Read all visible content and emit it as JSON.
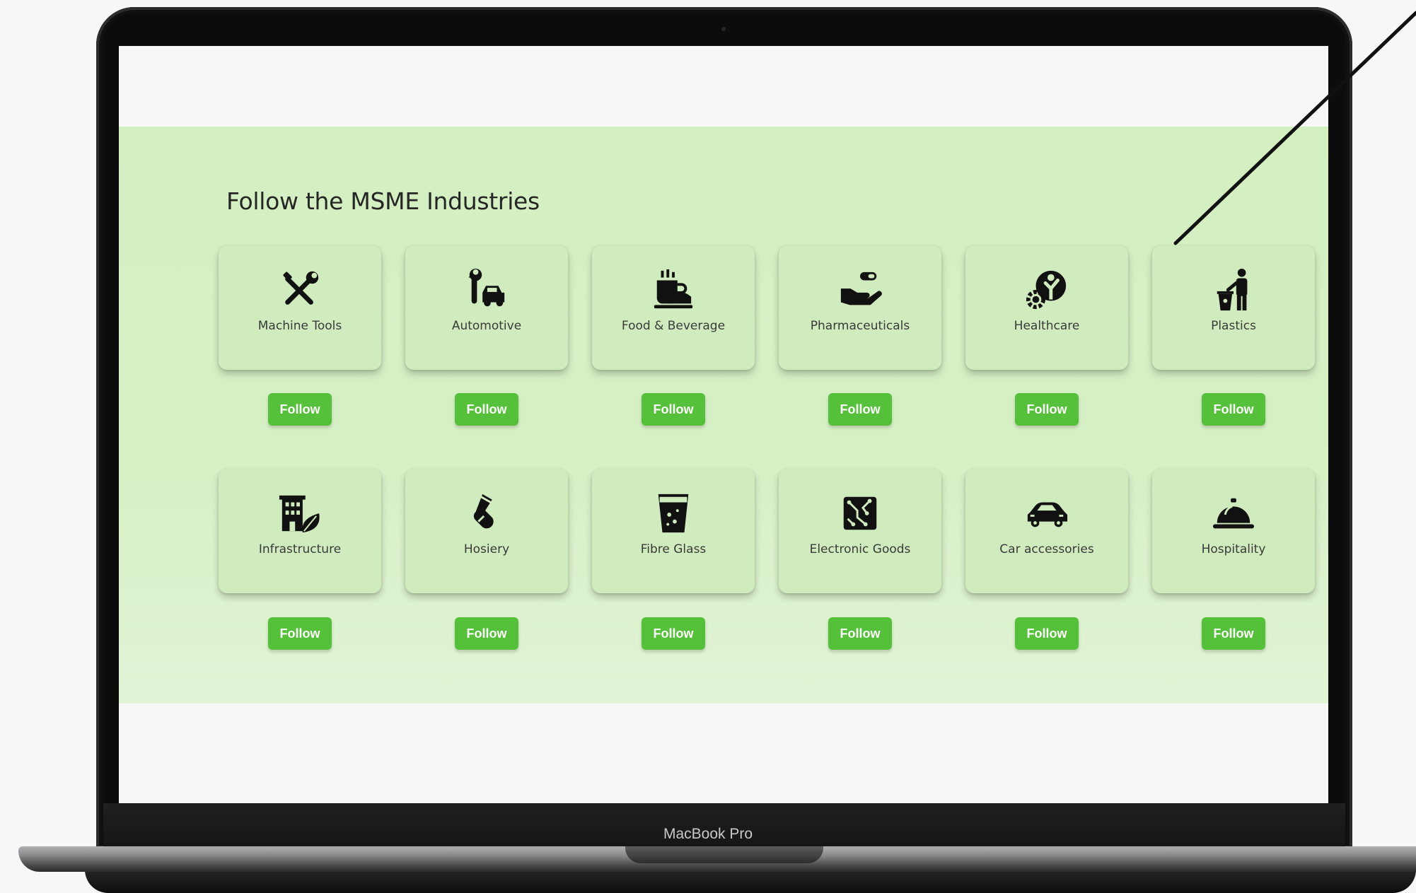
{
  "page": {
    "heading": "Follow the MSME Industries"
  },
  "device": {
    "label": "MacBook Pro"
  },
  "industries": [
    {
      "label": "Machine Tools",
      "icon": "tools-icon",
      "follow_label": "Follow"
    },
    {
      "label": "Automotive",
      "icon": "wrench-car-icon",
      "follow_label": "Follow"
    },
    {
      "label": "Food & Beverage",
      "icon": "food-beverage-icon",
      "follow_label": "Follow"
    },
    {
      "label": "Pharmaceuticals",
      "icon": "hand-pill-icon",
      "follow_label": "Follow"
    },
    {
      "label": "Healthcare",
      "icon": "healthcare-gear-icon",
      "follow_label": "Follow"
    },
    {
      "label": "Plastics",
      "icon": "person-trash-icon",
      "follow_label": "Follow"
    },
    {
      "label": "Infrastructure",
      "icon": "building-leaf-icon",
      "follow_label": "Follow"
    },
    {
      "label": "Hosiery",
      "icon": "sock-icon",
      "follow_label": "Follow"
    },
    {
      "label": "Fibre Glass",
      "icon": "glass-icon",
      "follow_label": "Follow"
    },
    {
      "label": "Electronic Goods",
      "icon": "circuit-board-icon",
      "follow_label": "Follow"
    },
    {
      "label": "Car accessories",
      "icon": "car-icon",
      "follow_label": "Follow"
    },
    {
      "label": "Hospitality",
      "icon": "service-bell-icon",
      "follow_label": "Follow"
    }
  ],
  "colors": {
    "band": "#d3efc0",
    "card": "#d0ebbd",
    "button": "#55c03a",
    "button_text": "#ffffff",
    "icon": "#111111"
  }
}
